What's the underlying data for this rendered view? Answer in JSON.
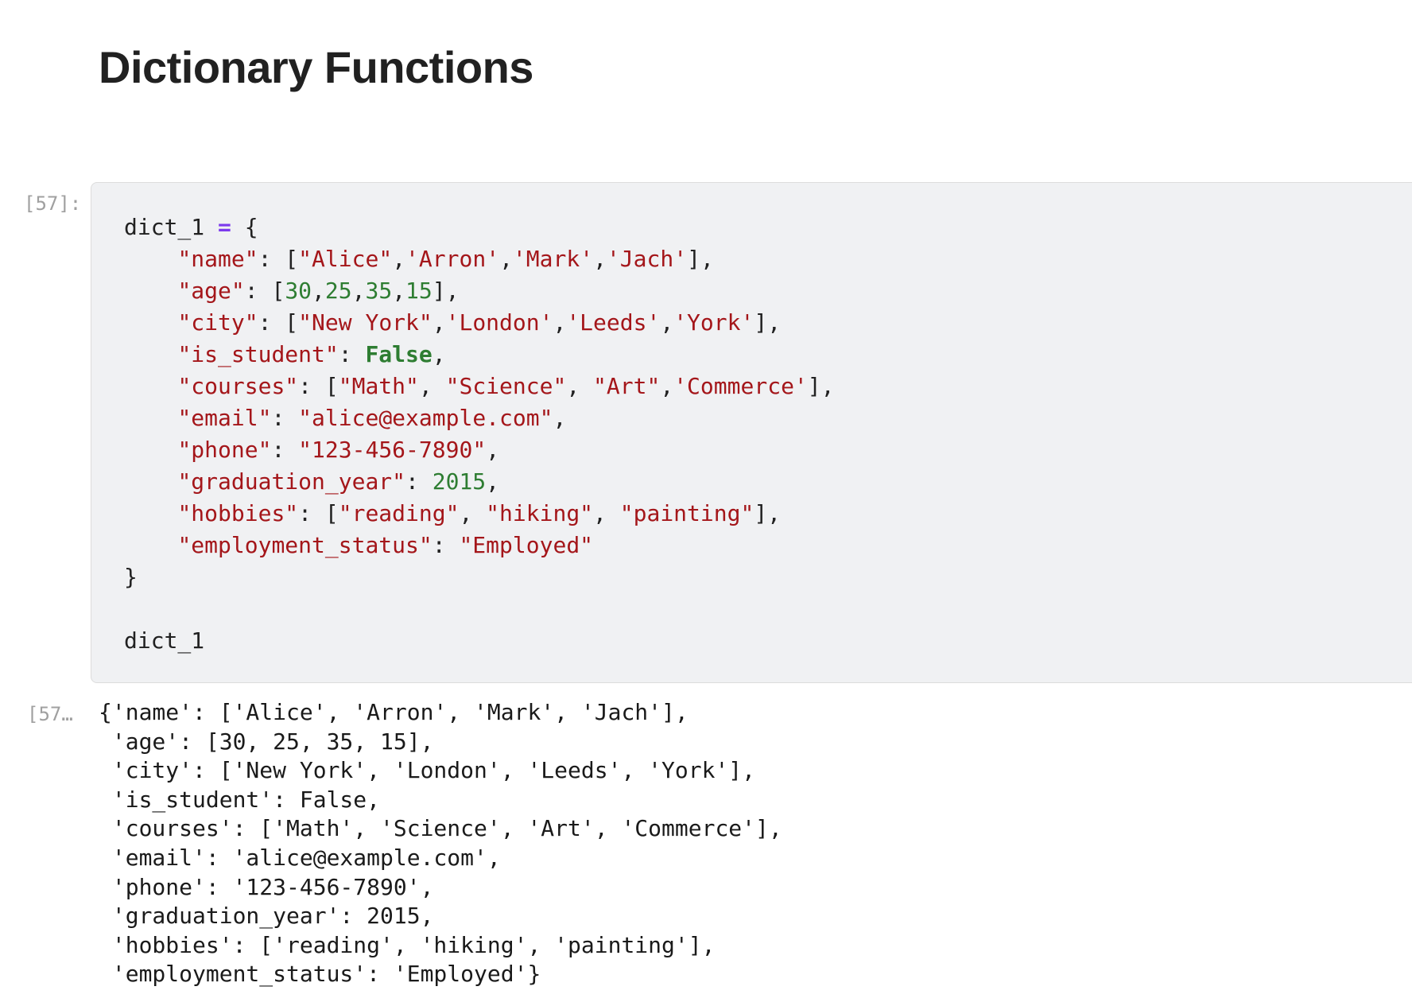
{
  "notebook": {
    "heading": "Dictionary Functions",
    "cells": [
      {
        "input_prompt": "[57]:",
        "output_prompt": "[57…",
        "code_lines": [
          [
            [
              "dict_1 ",
              "plain"
            ],
            [
              "=",
              "op"
            ],
            [
              " {",
              "plain"
            ]
          ],
          [
            [
              "    ",
              "plain"
            ],
            [
              "\"name\"",
              "str"
            ],
            [
              ": [",
              "plain"
            ],
            [
              "\"Alice\"",
              "str"
            ],
            [
              ",",
              "plain"
            ],
            [
              "'Arron'",
              "str"
            ],
            [
              ",",
              "plain"
            ],
            [
              "'Mark'",
              "str"
            ],
            [
              ",",
              "plain"
            ],
            [
              "'Jach'",
              "str"
            ],
            [
              "],",
              "plain"
            ]
          ],
          [
            [
              "    ",
              "plain"
            ],
            [
              "\"age\"",
              "str"
            ],
            [
              ": [",
              "plain"
            ],
            [
              "30",
              "num"
            ],
            [
              ",",
              "plain"
            ],
            [
              "25",
              "num"
            ],
            [
              ",",
              "plain"
            ],
            [
              "35",
              "num"
            ],
            [
              ",",
              "plain"
            ],
            [
              "15",
              "num"
            ],
            [
              "],",
              "plain"
            ]
          ],
          [
            [
              "    ",
              "plain"
            ],
            [
              "\"city\"",
              "str"
            ],
            [
              ": [",
              "plain"
            ],
            [
              "\"New York\"",
              "str"
            ],
            [
              ",",
              "plain"
            ],
            [
              "'London'",
              "str"
            ],
            [
              ",",
              "plain"
            ],
            [
              "'Leeds'",
              "str"
            ],
            [
              ",",
              "plain"
            ],
            [
              "'York'",
              "str"
            ],
            [
              "],",
              "plain"
            ]
          ],
          [
            [
              "    ",
              "plain"
            ],
            [
              "\"is_student\"",
              "str"
            ],
            [
              ": ",
              "plain"
            ],
            [
              "False",
              "kw"
            ],
            [
              ",",
              "plain"
            ]
          ],
          [
            [
              "    ",
              "plain"
            ],
            [
              "\"courses\"",
              "str"
            ],
            [
              ": [",
              "plain"
            ],
            [
              "\"Math\"",
              "str"
            ],
            [
              ", ",
              "plain"
            ],
            [
              "\"Science\"",
              "str"
            ],
            [
              ", ",
              "plain"
            ],
            [
              "\"Art\"",
              "str"
            ],
            [
              ",",
              "plain"
            ],
            [
              "'Commerce'",
              "str"
            ],
            [
              "],",
              "plain"
            ]
          ],
          [
            [
              "    ",
              "plain"
            ],
            [
              "\"email\"",
              "str"
            ],
            [
              ": ",
              "plain"
            ],
            [
              "\"alice@example.com\"",
              "str"
            ],
            [
              ",",
              "plain"
            ]
          ],
          [
            [
              "    ",
              "plain"
            ],
            [
              "\"phone\"",
              "str"
            ],
            [
              ": ",
              "plain"
            ],
            [
              "\"123-456-7890\"",
              "str"
            ],
            [
              ",",
              "plain"
            ]
          ],
          [
            [
              "    ",
              "plain"
            ],
            [
              "\"graduation_year\"",
              "str"
            ],
            [
              ": ",
              "plain"
            ],
            [
              "2015",
              "num"
            ],
            [
              ",",
              "plain"
            ]
          ],
          [
            [
              "    ",
              "plain"
            ],
            [
              "\"hobbies\"",
              "str"
            ],
            [
              ": [",
              "plain"
            ],
            [
              "\"reading\"",
              "str"
            ],
            [
              ", ",
              "plain"
            ],
            [
              "\"hiking\"",
              "str"
            ],
            [
              ", ",
              "plain"
            ],
            [
              "\"painting\"",
              "str"
            ],
            [
              "],",
              "plain"
            ]
          ],
          [
            [
              "    ",
              "plain"
            ],
            [
              "\"employment_status\"",
              "str"
            ],
            [
              ": ",
              "plain"
            ],
            [
              "\"Employed\"",
              "str"
            ]
          ],
          [
            [
              "}",
              "plain"
            ]
          ],
          [
            [
              "",
              "plain"
            ]
          ],
          [
            [
              "dict_1",
              "plain"
            ]
          ]
        ],
        "output_lines": [
          "{'name': ['Alice', 'Arron', 'Mark', 'Jach'],",
          " 'age': [30, 25, 35, 15],",
          " 'city': ['New York', 'London', 'Leeds', 'York'],",
          " 'is_student': False,",
          " 'courses': ['Math', 'Science', 'Art', 'Commerce'],",
          " 'email': 'alice@example.com',",
          " 'phone': '123-456-7890',",
          " 'graduation_year': 2015,",
          " 'hobbies': ['reading', 'hiking', 'painting'],",
          " 'employment_status': 'Employed'}"
        ]
      }
    ]
  },
  "colors": {
    "keyword_operator": "#7c3aed",
    "string": "#a4161a",
    "number": "#2e7d32",
    "boolean_keyword": "#2e7d32",
    "cell_background": "#f0f1f3",
    "prompt": "#a0a0a0"
  }
}
